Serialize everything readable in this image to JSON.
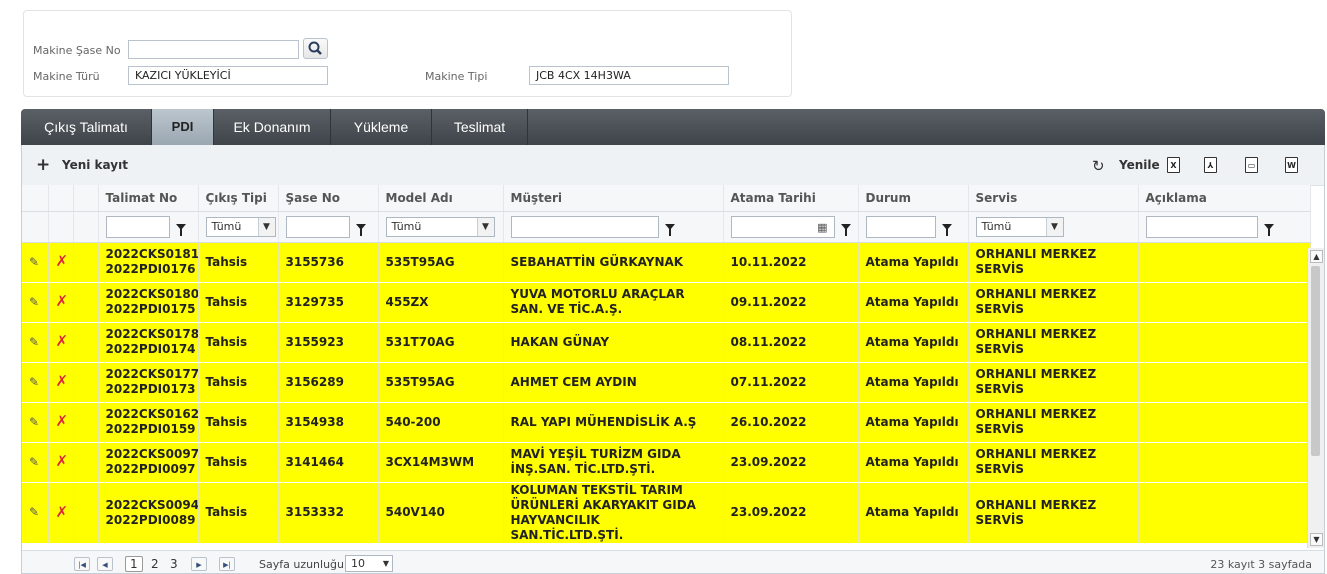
{
  "filter": {
    "chassis_label": "Makine Şase No",
    "chassis_value": "",
    "type_label": "Makine Türü",
    "type_value": "KAZICI YÜKLEYİCİ",
    "model_type_label": "Makine Tipi",
    "model_type_value": "JCB 4CX 14H3WA"
  },
  "tabs": [
    {
      "label": "Çıkış Talimatı",
      "active": false
    },
    {
      "label": "PDI",
      "active": true
    },
    {
      "label": "Ek Donanım",
      "active": false
    },
    {
      "label": "Yükleme",
      "active": false
    },
    {
      "label": "Teslimat",
      "active": false
    }
  ],
  "toolbar": {
    "new_label": "Yeni kayıt",
    "refresh_label": "Yenile",
    "export_icons": [
      "excel-icon",
      "pdf-icon",
      "csv-icon",
      "word-icon"
    ]
  },
  "columns": [
    "Talimat No",
    "Çıkış Tipi",
    "Şase No",
    "Model Adı",
    "Müşteri",
    "Atama Tarihi",
    "Durum",
    "Servis",
    "Açıklama"
  ],
  "filter_row": {
    "select_all": "Tümü"
  },
  "rows": [
    {
      "talimat": "2022CKS0181-2022PDI0176",
      "tip": "Tahsis",
      "sase": "3155736",
      "model": "535T95AG",
      "musteri": "SEBAHATTİN GÜRKAYNAK",
      "tarih": "10.11.2022",
      "durum": "Atama Yapıldı",
      "servis": "ORHANLI MERKEZ SERVİS",
      "aciklama": ""
    },
    {
      "talimat": "2022CKS0180-2022PDI0175",
      "tip": "Tahsis",
      "sase": "3129735",
      "model": "455ZX",
      "musteri": "YUVA MOTORLU ARAÇLAR SAN. VE TİC.A.Ş.",
      "tarih": "09.11.2022",
      "durum": "Atama Yapıldı",
      "servis": "ORHANLI MERKEZ SERVİS",
      "aciklama": ""
    },
    {
      "talimat": "2022CKS0178-2022PDI0174",
      "tip": "Tahsis",
      "sase": "3155923",
      "model": "531T70AG",
      "musteri": "HAKAN GÜNAY",
      "tarih": "08.11.2022",
      "durum": "Atama Yapıldı",
      "servis": "ORHANLI MERKEZ SERVİS",
      "aciklama": ""
    },
    {
      "talimat": "2022CKS0177-2022PDI0173",
      "tip": "Tahsis",
      "sase": "3156289",
      "model": "535T95AG",
      "musteri": "AHMET CEM AYDIN",
      "tarih": "07.11.2022",
      "durum": "Atama Yapıldı",
      "servis": "ORHANLI MERKEZ SERVİS",
      "aciklama": ""
    },
    {
      "talimat": "2022CKS0162-2022PDI0159",
      "tip": "Tahsis",
      "sase": "3154938",
      "model": "540-200",
      "musteri": "RAL YAPI MÜHENDİSLİK A.Ş",
      "tarih": "26.10.2022",
      "durum": "Atama Yapıldı",
      "servis": "ORHANLI MERKEZ SERVİS",
      "aciklama": ""
    },
    {
      "talimat": "2022CKS0097-2022PDI0097",
      "tip": "Tahsis",
      "sase": "3141464",
      "model": "3CX14M3WM",
      "musteri": "MAVİ YEŞİL TURİZM GIDA İNŞ.SAN. TİC.LTD.ŞTİ.",
      "tarih": "23.09.2022",
      "durum": "Atama Yapıldı",
      "servis": "ORHANLI MERKEZ SERVİS",
      "aciklama": ""
    },
    {
      "talimat": "2022CKS0094-2022PDI0089",
      "tip": "Tahsis",
      "sase": "3153332",
      "model": "540V140",
      "musteri": "KOLUMAN TEKSTİL TARIM ÜRÜNLERİ AKARYAKIT GIDA HAYVANCILIK SAN.TİC.LTD.ŞTİ.",
      "tarih": "23.09.2022",
      "durum": "Atama Yapıldı",
      "servis": "ORHANLI MERKEZ SERVİS",
      "aciklama": ""
    }
  ],
  "pager": {
    "pages": [
      "1",
      "2",
      "3"
    ],
    "current": "1",
    "size_label": "Sayfa uzunluğu:",
    "size_value": "10",
    "info": "23 kayıt 3 sayfada"
  },
  "colors": {
    "row_highlight": "#ffff00",
    "tab_bar": "#4a5055",
    "delete": "#e0263a"
  }
}
